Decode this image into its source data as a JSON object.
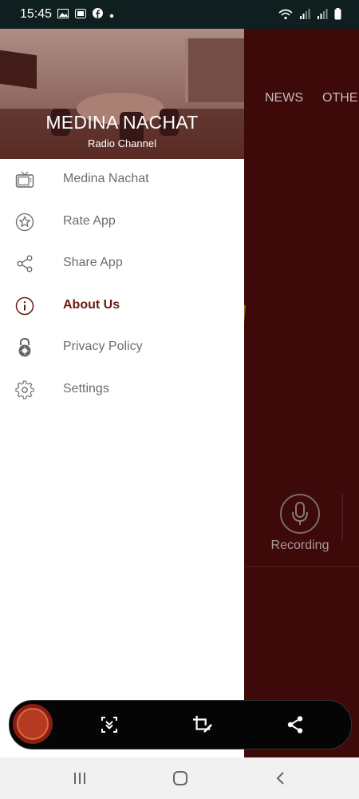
{
  "status_bar": {
    "time": "15:45",
    "left_icons": [
      "image-icon",
      "sim-icon",
      "facebook-icon",
      "dot-icon"
    ],
    "right_icons": [
      "wifi-icon",
      "signal-icon",
      "signal-icon",
      "battery-icon"
    ]
  },
  "drawer": {
    "header": {
      "title": "MEDINA NACHAT",
      "subtitle": "Radio Channel"
    },
    "items": [
      {
        "label": "Medina Nachat",
        "icon": "tv-icon",
        "active": false
      },
      {
        "label": "Rate App",
        "icon": "star-icon",
        "active": false
      },
      {
        "label": "Share App",
        "icon": "share-icon",
        "active": false
      },
      {
        "label": "About Us",
        "icon": "info-icon",
        "active": true
      },
      {
        "label": "Privacy Policy",
        "icon": "lock-icon",
        "active": false
      },
      {
        "label": "Settings",
        "icon": "gear-icon",
        "active": false
      }
    ]
  },
  "background_app": {
    "tabs": [
      "NEWS",
      "OTHE"
    ],
    "recording_label": "Recording"
  },
  "capture_toolbar": {
    "buttons": [
      "scroll-capture-icon",
      "crop-edit-icon",
      "share-icon"
    ]
  },
  "nav_bar": {
    "buttons": [
      "recents-icon",
      "home-icon",
      "back-icon"
    ]
  },
  "colors": {
    "status_bar": "#0f1f20",
    "background_app": "#3d0909",
    "active_item": "#6a1a10",
    "menu_text": "#6d6d6d"
  }
}
